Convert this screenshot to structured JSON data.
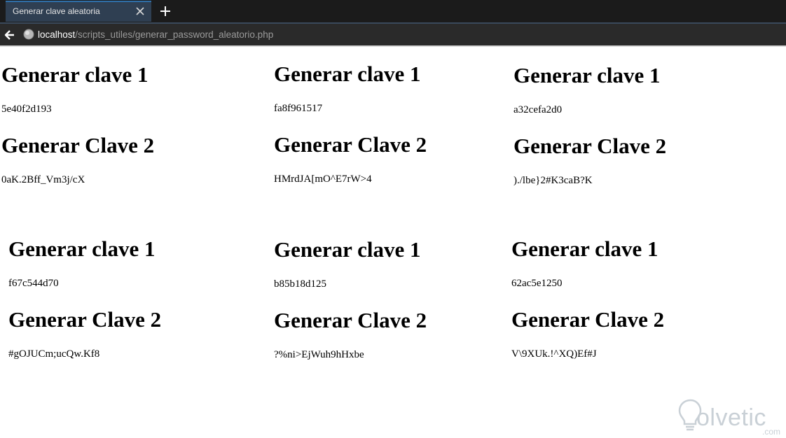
{
  "browser": {
    "tab_title": "Generar clave aleatoria",
    "url_host": "localhost",
    "url_path": "/scripts_utiles/generar_password_aleatorio.php"
  },
  "icons": {
    "tab_close": "close-icon",
    "new_tab": "plus-icon",
    "back": "arrow-left-icon",
    "site": "globe-icon"
  },
  "blocks": [
    {
      "heading1": "Generar clave 1",
      "key1": "5e40f2d193",
      "heading2": "Generar Clave 2",
      "key2": "0aK.2Bff_Vm3j/cX"
    },
    {
      "heading1": "Generar clave 1",
      "key1": "fa8f961517",
      "heading2": "Generar Clave 2",
      "key2": "HMrdJA[mO^E7rW>4"
    },
    {
      "heading1": "Generar clave 1",
      "key1": "a32cefa2d0",
      "heading2": "Generar Clave 2",
      "key2": ")./lbe}2#K3caB?K"
    },
    {
      "heading1": "Generar clave 1",
      "key1": "f67c544d70",
      "heading2": "Generar Clave 2",
      "key2": "#gOJUCm;ucQw.Kf8"
    },
    {
      "heading1": "Generar clave 1",
      "key1": "b85b18d125",
      "heading2": "Generar Clave 2",
      "key2": "?%ni>EjWuh9hHxbe"
    },
    {
      "heading1": "Generar clave 1",
      "key1": "62ac5e1250",
      "heading2": "Generar Clave 2",
      "key2": "V\\9XUk.!^XQ)Ef#J"
    }
  ],
  "watermark": {
    "brand": "olvetic",
    "suffix": ".com"
  }
}
